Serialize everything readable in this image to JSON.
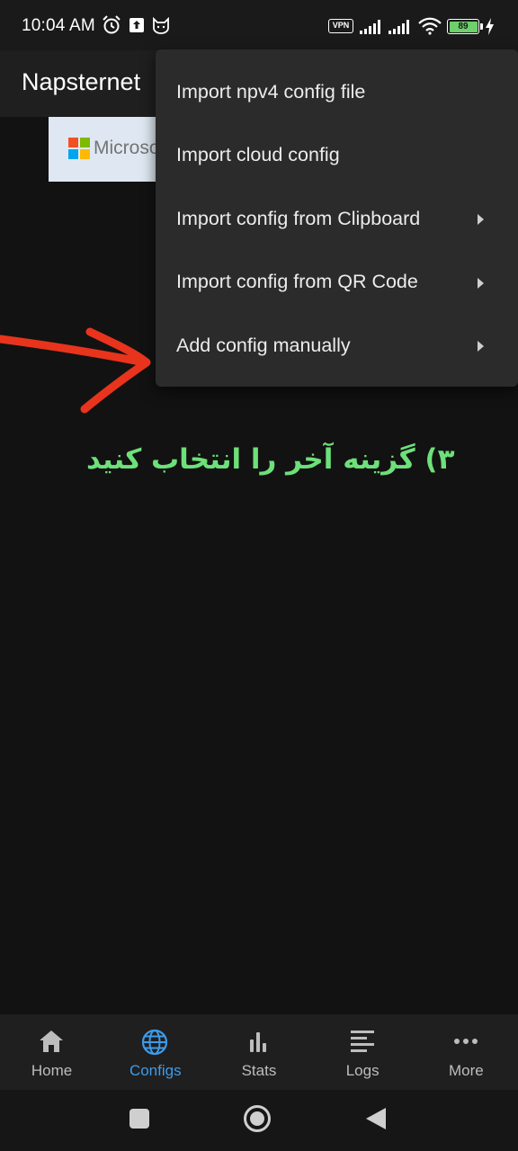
{
  "status_bar": {
    "time": "10:04 AM",
    "vpn_label": "VPN",
    "battery_level": "89",
    "icons": [
      "alarm-icon",
      "upload-icon",
      "cat-icon",
      "vpn-icon",
      "signal-icon",
      "signal-icon",
      "wifi-icon",
      "battery-icon",
      "charging-icon"
    ]
  },
  "app_bar": {
    "title": "Napsternet"
  },
  "banner": {
    "logo_text": "Microso"
  },
  "menu": {
    "items": [
      {
        "label": "Import npv4 config file",
        "has_submenu": false
      },
      {
        "label": "Import cloud config",
        "has_submenu": false
      },
      {
        "label": "Import config from Clipboard",
        "has_submenu": true
      },
      {
        "label": "Import config from QR Code",
        "has_submenu": true
      },
      {
        "label": "Add config manually",
        "has_submenu": true
      }
    ]
  },
  "annotation": {
    "text": "۳) گزینه آخر را انتخاب کنید",
    "text_color": "#6de07a",
    "arrow_color": "#e8341c"
  },
  "bottom_nav": {
    "active_color": "#3d9be9",
    "items": [
      {
        "label": "Home",
        "icon": "home-icon",
        "active": false
      },
      {
        "label": "Configs",
        "icon": "globe-icon",
        "active": true
      },
      {
        "label": "Stats",
        "icon": "bar-chart-icon",
        "active": false
      },
      {
        "label": "Logs",
        "icon": "list-icon",
        "active": false
      },
      {
        "label": "More",
        "icon": "more-horizontal-icon",
        "active": false
      }
    ]
  },
  "system_nav": {
    "icons": [
      "recents-icon",
      "home-circle-icon",
      "back-icon"
    ]
  }
}
